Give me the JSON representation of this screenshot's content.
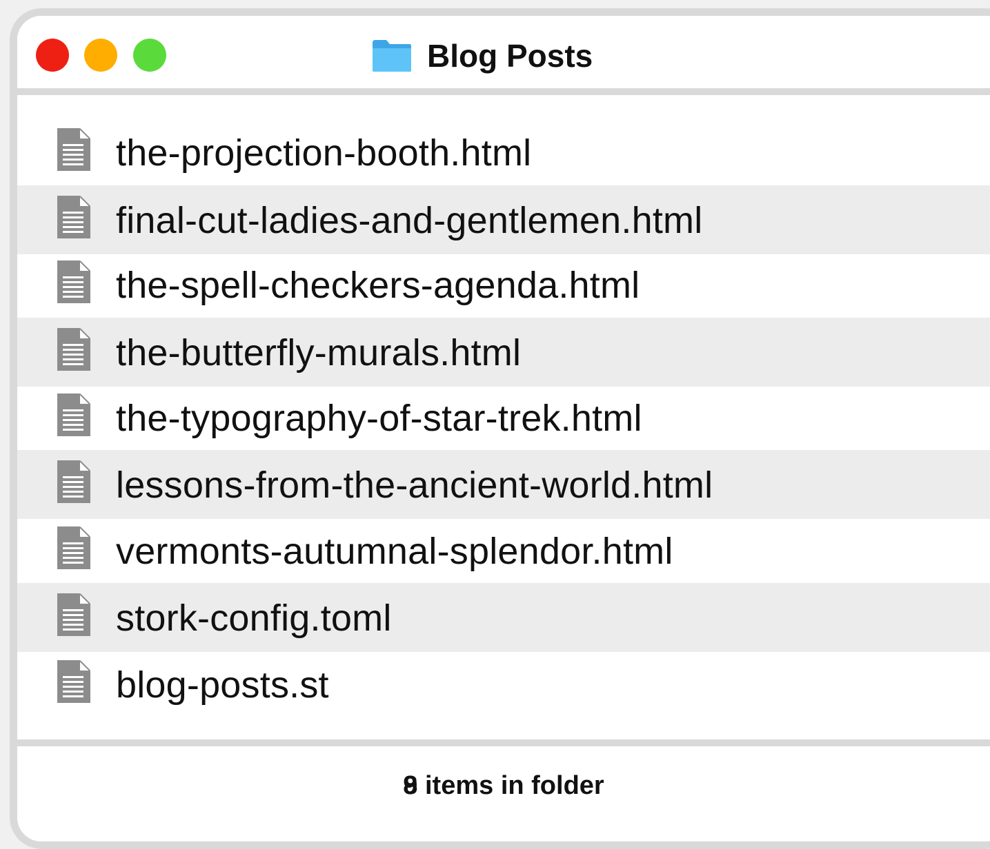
{
  "window": {
    "title": "Blog Posts",
    "folder_icon": "folder-icon",
    "controls": {
      "close_color": "#ee2013",
      "minimize_color": "#ffad00",
      "zoom_color": "#5bdb3b"
    }
  },
  "files": [
    {
      "name": "the-projection-booth.html",
      "icon": "document-icon"
    },
    {
      "name": "final-cut-ladies-and-gentlemen.html",
      "icon": "document-icon"
    },
    {
      "name": "the-spell-checkers-agenda.html",
      "icon": "document-icon"
    },
    {
      "name": "the-butterfly-murals.html",
      "icon": "document-icon"
    },
    {
      "name": "the-typography-of-star-trek.html",
      "icon": "document-icon"
    },
    {
      "name": "lessons-from-the-ancient-world.html",
      "icon": "document-icon"
    },
    {
      "name": "vermonts-autumnal-splendor.html",
      "icon": "document-icon"
    },
    {
      "name": "stork-config.toml",
      "icon": "document-icon"
    },
    {
      "name": "blog-posts.st",
      "icon": "document-icon"
    }
  ],
  "footer": {
    "status": "8 items in folder",
    "status_overprint_digit": "9"
  }
}
